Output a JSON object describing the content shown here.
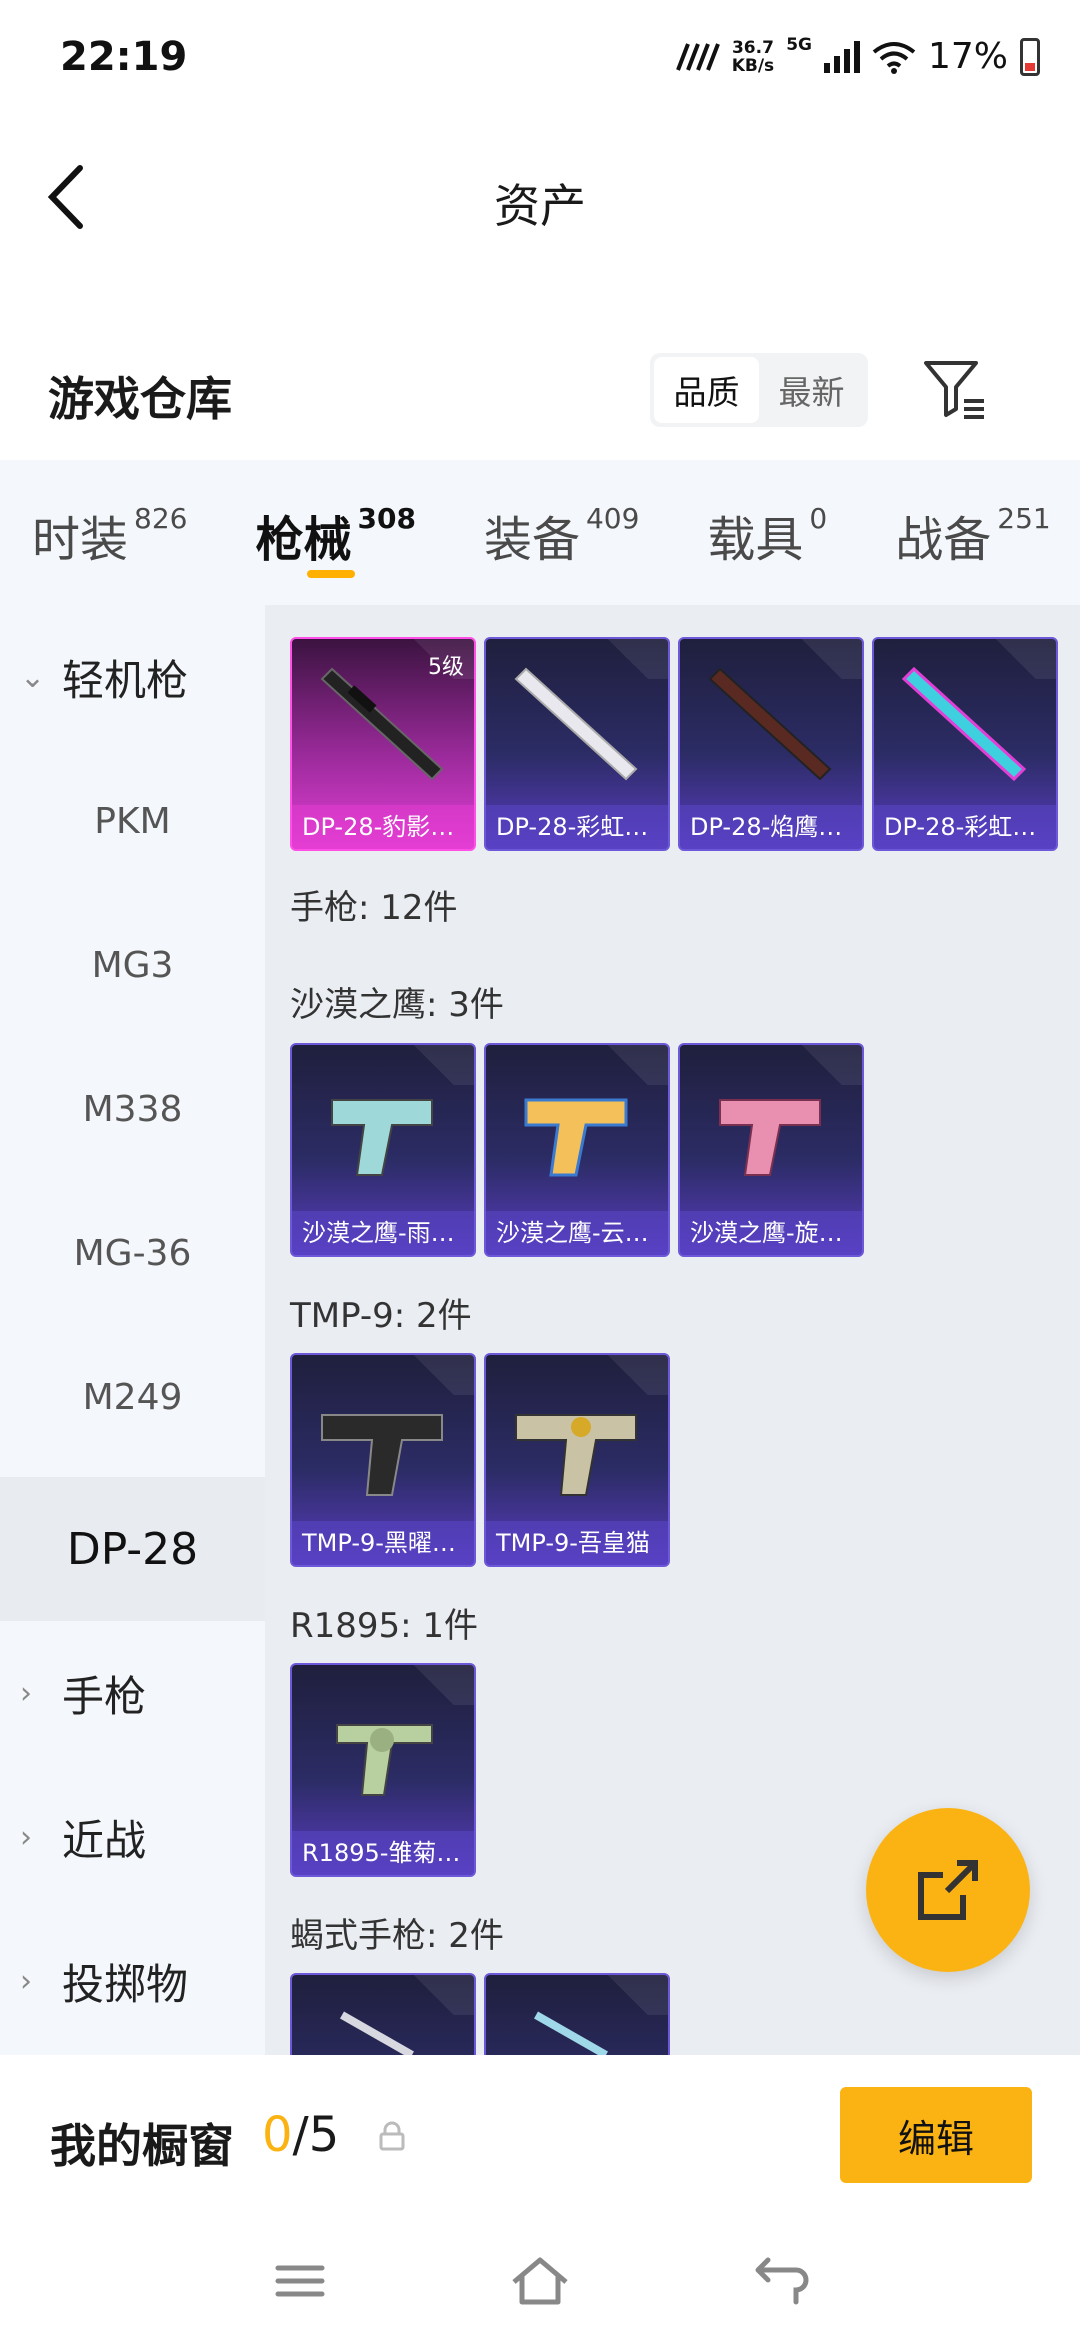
{
  "status": {
    "time": "22:19",
    "net_speed_value": "36.7",
    "net_speed_unit": "KB/s",
    "network": "5G",
    "battery": "17%"
  },
  "header": {
    "title": "资产"
  },
  "warehouse": {
    "title": "游戏仓库",
    "sort_options": [
      "品质",
      "最新"
    ]
  },
  "tabs": [
    {
      "label": "时装",
      "count": "826"
    },
    {
      "label": "枪械",
      "count": "308"
    },
    {
      "label": "装备",
      "count": "409"
    },
    {
      "label": "载具",
      "count": "0"
    },
    {
      "label": "战备",
      "count": "251"
    }
  ],
  "sidebar": {
    "group_open": "轻机枪",
    "items": [
      "PKM",
      "MG3",
      "M338",
      "MG-36",
      "M249",
      "DP-28"
    ],
    "groups": [
      "手枪",
      "近战",
      "投掷物"
    ]
  },
  "content": {
    "dp28_cards": [
      {
        "name": "DP-28-豹影…",
        "level": "5级"
      },
      {
        "name": "DP-28-彩虹…"
      },
      {
        "name": "DP-28-焰鹰…"
      },
      {
        "name": "DP-28-彩虹…"
      }
    ],
    "pistol_total": "手枪: 12件",
    "desert_eagle_label": "沙漠之鹰: 3件",
    "desert_eagle_cards": [
      "沙漠之鹰-雨…",
      "沙漠之鹰-云…",
      "沙漠之鹰-旋…"
    ],
    "tmp9_label": "TMP-9: 2件",
    "tmp9_cards": [
      "TMP-9-黑曜…",
      "TMP-9-吾皇猫"
    ],
    "r1895_label": "R1895: 1件",
    "r1895_cards": [
      "R1895-雏菊…"
    ],
    "scorpion_label": "蝎式手枪: 2件"
  },
  "window": {
    "title": "我的橱窗",
    "count_current": "0",
    "count_total": "/5",
    "edit_label": "编辑"
  }
}
